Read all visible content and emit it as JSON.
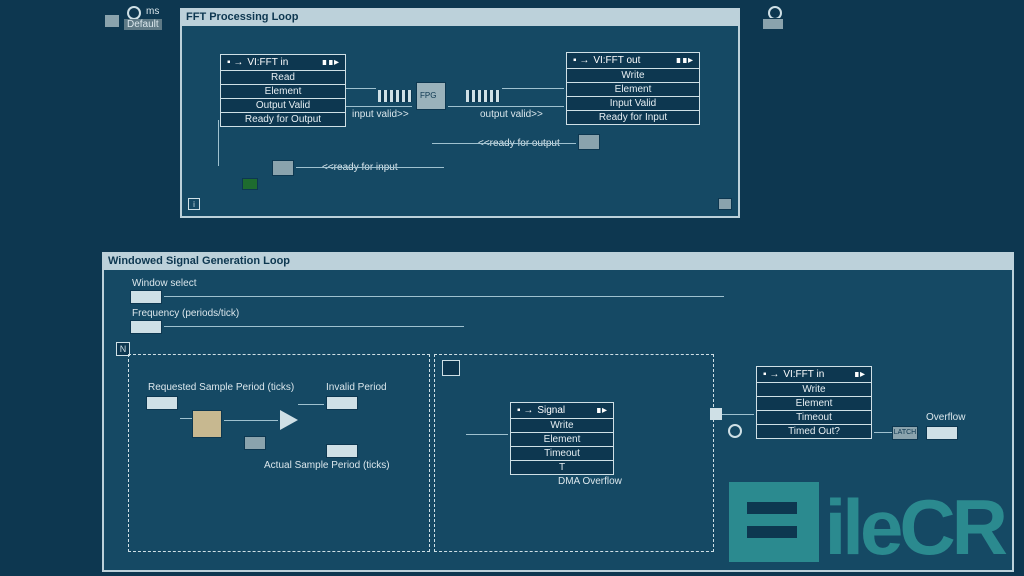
{
  "panel_fft": {
    "title": "FFT Processing Loop",
    "in": {
      "hdr": "VI:FFT in",
      "rows": [
        "Read",
        "Element",
        "Output Valid",
        "Ready for Output"
      ]
    },
    "out": {
      "hdr": "VI:FFT out",
      "rows": [
        "Write",
        "Element",
        "Input Valid",
        "Ready for Input"
      ]
    },
    "labels": {
      "input_valid": "input valid>>",
      "output_valid": "output valid>>",
      "ready_for_output": "<<ready for output",
      "ready_for_input": "<<ready for input"
    }
  },
  "top_left_tag": "ms",
  "top_left_sub": "Default",
  "panel_win": {
    "title": "Windowed Signal Generation Loop",
    "window_select": "Window select",
    "frequency": "Frequency (periods/tick)",
    "requested": "Requested Sample Period (ticks)",
    "actual": "Actual Sample Period (ticks)",
    "invalid": "Invalid Period",
    "dma": "DMA Overflow",
    "signal": {
      "hdr": "Signal",
      "rows": [
        "Write",
        "Element",
        "Timeout",
        "T"
      ]
    },
    "fft_in": {
      "hdr": "VI:FFT in",
      "rows": [
        "Write",
        "Element",
        "Timeout",
        "Timed Out?"
      ]
    },
    "overflow": "Overflow"
  },
  "watermark": "ileCR"
}
